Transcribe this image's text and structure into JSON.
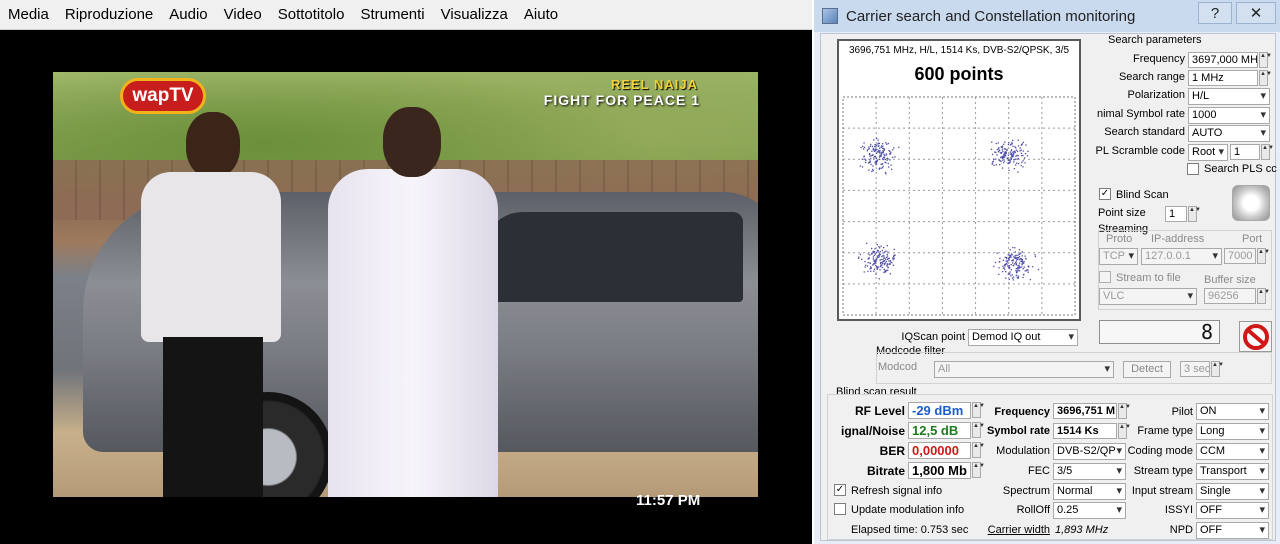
{
  "player": {
    "menu": [
      "Media",
      "Riproduzione",
      "Audio",
      "Video",
      "Sottotitolo",
      "Strumenti",
      "Visualizza",
      "Aiuto"
    ],
    "logo": "wapTV",
    "channel_tag": "REEL NAIJA",
    "show_title": "FIGHT FOR PEACE 1",
    "clock": "11:57 PM"
  },
  "window": {
    "title": "Carrier search and Constellation monitoring",
    "help": "?",
    "close": "✕"
  },
  "constellation": {
    "header": "3696,751 MHz, H/L, 1514 Ks, DVB-S2/QPSK, 3/5",
    "points_label": "600 points"
  },
  "search": {
    "section": "Search parameters",
    "frequency_label": "Frequency",
    "frequency_value": "3697,000 MHz",
    "range_label": "Search range",
    "range_value": "1 MHz",
    "polarization_label": "Polarization",
    "polarization_value": "H/L",
    "symbol_label": "nimal Symbol rate",
    "symbol_value": "1000",
    "standard_label": "Search standard",
    "standard_value": "AUTO",
    "pl_label": "PL Scramble code",
    "pl_mode": "Root",
    "pl_value": "1",
    "search_pls": "Search PLS cc",
    "blind_scan": "Blind Scan",
    "point_size_label": "Point size",
    "point_size_value": "1"
  },
  "streaming": {
    "section": "Streaming",
    "proto_label": "Proto",
    "ip_label": "IP-address",
    "port_label": "Port",
    "proto_value": "TCP",
    "ip_value": "127.0.0.1",
    "port_value": "7000",
    "stream_file": "Stream to file",
    "buffer_label": "Buffer size",
    "player_value": "VLC",
    "buffer_value": "96256"
  },
  "iq": {
    "label": "IQScan point",
    "value": "Demod IQ out",
    "counter": "8"
  },
  "modcode": {
    "section": "Modcode filter",
    "label": "Modcod",
    "value": "All",
    "detect": "Detect",
    "time": "3 sec"
  },
  "result": {
    "section": "Blind scan result",
    "rf_label": "RF Level",
    "rf_value": "-29 dBm",
    "sn_label": "ignal/Noise",
    "sn_value": "12,5 dB",
    "ber_label": "BER",
    "ber_value": "0,00000",
    "bitrate_label": "Bitrate",
    "bitrate_value": "1,800 Mb",
    "freq_label": "Frequency",
    "freq_value": "3696,751 M",
    "sr_label": "Symbol rate",
    "sr_value": "1514 Ks",
    "mod_label": "Modulation",
    "mod_value": "DVB-S2/QP",
    "fec_label": "FEC",
    "fec_value": "3/5",
    "spectrum_label": "Spectrum",
    "spectrum_value": "Normal",
    "rolloff_label": "RollOff",
    "rolloff_value": "0.25",
    "cw_label": "Carrier width",
    "cw_value": "1,893 MHz",
    "pilot_label": "Pilot",
    "pilot_value": "ON",
    "frame_label": "Frame type",
    "frame_value": "Long",
    "coding_label": "Coding mode",
    "coding_value": "CCM",
    "stype_label": "Stream type",
    "stype_value": "Transport",
    "input_label": "Input stream",
    "input_value": "Single",
    "issyi_label": "ISSYI",
    "issyi_value": "OFF",
    "npd_label": "NPD",
    "npd_value": "OFF",
    "refresh": "Refresh signal info",
    "update_mod": "Update modulation info",
    "elapsed": "Elapsed time: 0.753 sec"
  },
  "colors": {
    "rf": "#1a5fc8",
    "sn": "#1d7a1d",
    "ber": "#d01818",
    "points": "#4d4da8"
  }
}
